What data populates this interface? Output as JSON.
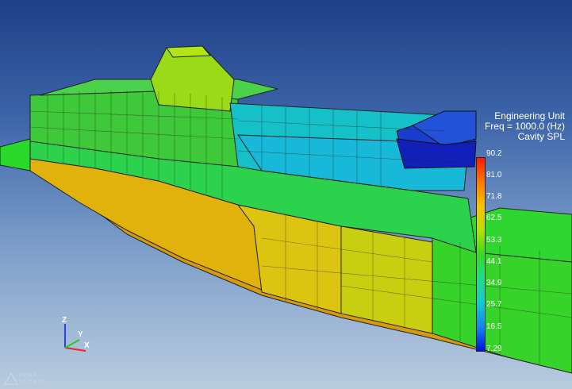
{
  "legend": {
    "title_lines": [
      "Engineering Unit",
      "Freq = 1000.0 (Hz)",
      "Cavity SPL"
    ],
    "ticks": [
      "90.2",
      "81.0",
      "71.8",
      "62.5",
      "53.3",
      "44.1",
      "34.9",
      "25.7",
      "16.5",
      "7.29"
    ],
    "gradient_colors": [
      "#ff1a00",
      "#ff7a00",
      "#f5c400",
      "#b8e000",
      "#33dd22",
      "#22dd88",
      "#11cccc",
      "#1188ee",
      "#0011dd"
    ]
  },
  "triad": {
    "z": "Z",
    "y": "Y",
    "x": "X"
  },
  "logo": {
    "line1": "PERA",
    "line2": "GLOBAL"
  },
  "colors": {
    "background_top": "#1f3f87",
    "background_bottom": "#b9ccdf"
  }
}
